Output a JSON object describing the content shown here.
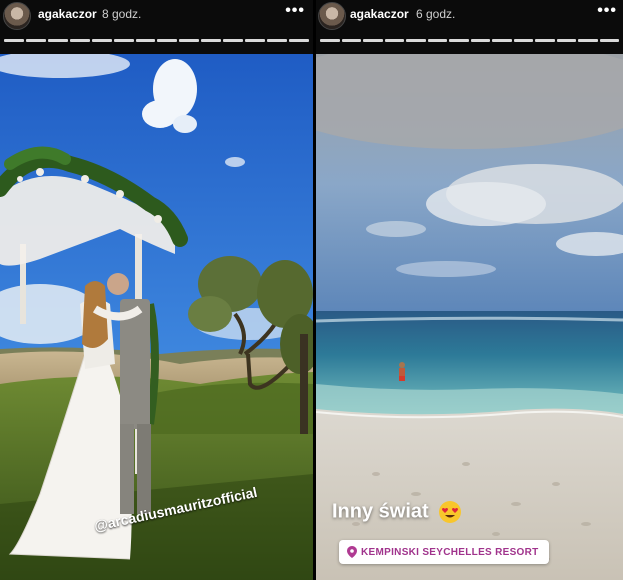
{
  "left_story": {
    "username": "agakaczor",
    "time_ago": "8 godz.",
    "more_icon": "more-horizontal-icon",
    "mention": "@arcadiusmauritzofficial",
    "progress": {
      "segments": 14,
      "active": 14
    }
  },
  "right_story": {
    "username": "agakaczor",
    "time_ago": "6 godz.",
    "more_icon": "more-horizontal-icon",
    "close_icon": "close-icon",
    "caption": "Inny świat",
    "caption_emoji": "heart-eyes-emoji",
    "location": "KEMPINSKI SEYCHELLES RESORT",
    "location_icon": "location-pin-icon",
    "progress": {
      "segments": 14,
      "active": 14
    }
  }
}
